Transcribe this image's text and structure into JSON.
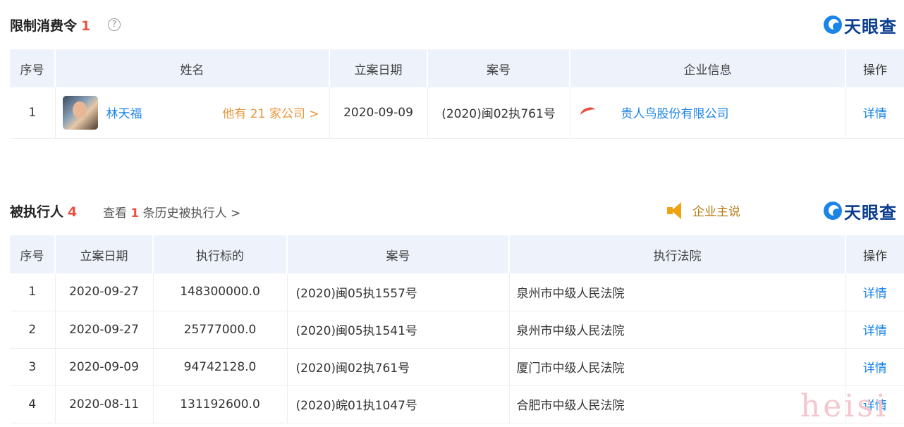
{
  "section1": {
    "title": "限制消费令",
    "count": "1",
    "help": "?",
    "logo_text": "天眼查",
    "columns": [
      "序号",
      "姓名",
      "立案日期",
      "案号",
      "企业信息",
      "操作"
    ],
    "rows": [
      {
        "index": "1",
        "name": "林天福",
        "more": "他有 21 家公司 >",
        "date": "2020-09-09",
        "case_no": "(2020)闽02执761号",
        "company": "贵人鸟股份有限公司",
        "action": "详情"
      }
    ]
  },
  "section2": {
    "title": "被执行人",
    "count": "4",
    "history_prefix": "查看 ",
    "history_num": "1",
    "history_suffix": " 条历史被执行人 >",
    "speaker_label": "企业主说",
    "logo_text": "天眼查",
    "columns": [
      "序号",
      "立案日期",
      "执行标的",
      "案号",
      "执行法院",
      "操作"
    ],
    "rows": [
      {
        "index": "1",
        "date": "2020-09-27",
        "amount": "148300000.0",
        "case_no": "(2020)闽05执1557号",
        "court": "泉州市中级人民法院",
        "action": "详情"
      },
      {
        "index": "2",
        "date": "2020-09-27",
        "amount": "25777000.0",
        "case_no": "(2020)闽05执1541号",
        "court": "泉州市中级人民法院",
        "action": "详情"
      },
      {
        "index": "3",
        "date": "2020-09-09",
        "amount": "94742128.0",
        "case_no": "(2020)闽02执761号",
        "court": "厦门市中级人民法院",
        "action": "详情"
      },
      {
        "index": "4",
        "date": "2020-08-11",
        "amount": "131192600.0",
        "case_no": "(2020)皖01执1047号",
        "court": "合肥市中级人民法院",
        "action": "详情"
      }
    ]
  },
  "watermark": "heisi",
  "colors": {
    "accent": "#1a84e8",
    "count": "#e8523f",
    "header_bg": "#eef3fb",
    "logo_text": "#0a3d8f",
    "orange": "#e8953a"
  }
}
